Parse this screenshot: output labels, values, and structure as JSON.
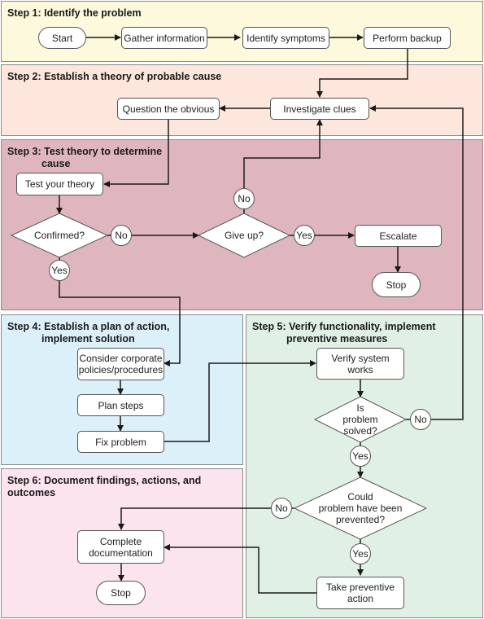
{
  "colors": {
    "step1_bg": "#fdf9dc",
    "step2_bg": "#fde6dc",
    "step3_bg": "#e0b6be",
    "step4_bg": "#dcf0fa",
    "step5_bg": "#e0f0e4",
    "step6_bg": "#fce4ee",
    "line": "#1a1a1a",
    "node_fill": "#ffffff"
  },
  "steps": [
    {
      "id": "step1",
      "title": "Step 1: Identify the problem"
    },
    {
      "id": "step2",
      "title": "Step 2: Establish a theory of probable cause"
    },
    {
      "id": "step3",
      "title_line1": "Step 3: Test theory to determine",
      "title_line2": "cause"
    },
    {
      "id": "step4",
      "title_line1": "Step 4: Establish a plan of action,",
      "title_line2": "implement solution"
    },
    {
      "id": "step5",
      "title_line1": "Step 5: Verify functionality, implement",
      "title_line2": "preventive measures"
    },
    {
      "id": "step6",
      "title": "Step 6: Document findings, actions, and outcomes"
    }
  ],
  "nodes": {
    "start": "Start",
    "gather_information": "Gather information",
    "identify_symptoms": "Identify symptoms",
    "perform_backup": "Perform backup",
    "question_obvious": "Question the obvious",
    "investigate_clues": "Investigate clues",
    "test_theory": "Test your theory",
    "confirmed": "Confirmed?",
    "give_up": "Give up?",
    "escalate": "Escalate",
    "stop_step3": "Stop",
    "consider_policies_l1": "Consider corporate",
    "consider_policies_l2": "policies/procedures",
    "plan_steps": "Plan steps",
    "fix_problem": "Fix problem",
    "verify_system_l1": "Verify system",
    "verify_system_l2": "works",
    "is_solved_l1": "Is",
    "is_solved_l2": "problem",
    "is_solved_l3": "solved?",
    "could_prevent_l1": "Could",
    "could_prevent_l2": "problem have been",
    "could_prevent_l3": "prevented?",
    "take_preventive_l1": "Take preventive",
    "take_preventive_l2": "action",
    "complete_doc_l1": "Complete",
    "complete_doc_l2": "documentation",
    "stop_step6": "Stop"
  },
  "labels": {
    "confirmed_no": "No",
    "confirmed_yes": "Yes",
    "giveup_no": "No",
    "giveup_yes": "Yes",
    "solved_no": "No",
    "solved_yes": "Yes",
    "prevent_no": "No",
    "prevent_yes": "Yes"
  }
}
